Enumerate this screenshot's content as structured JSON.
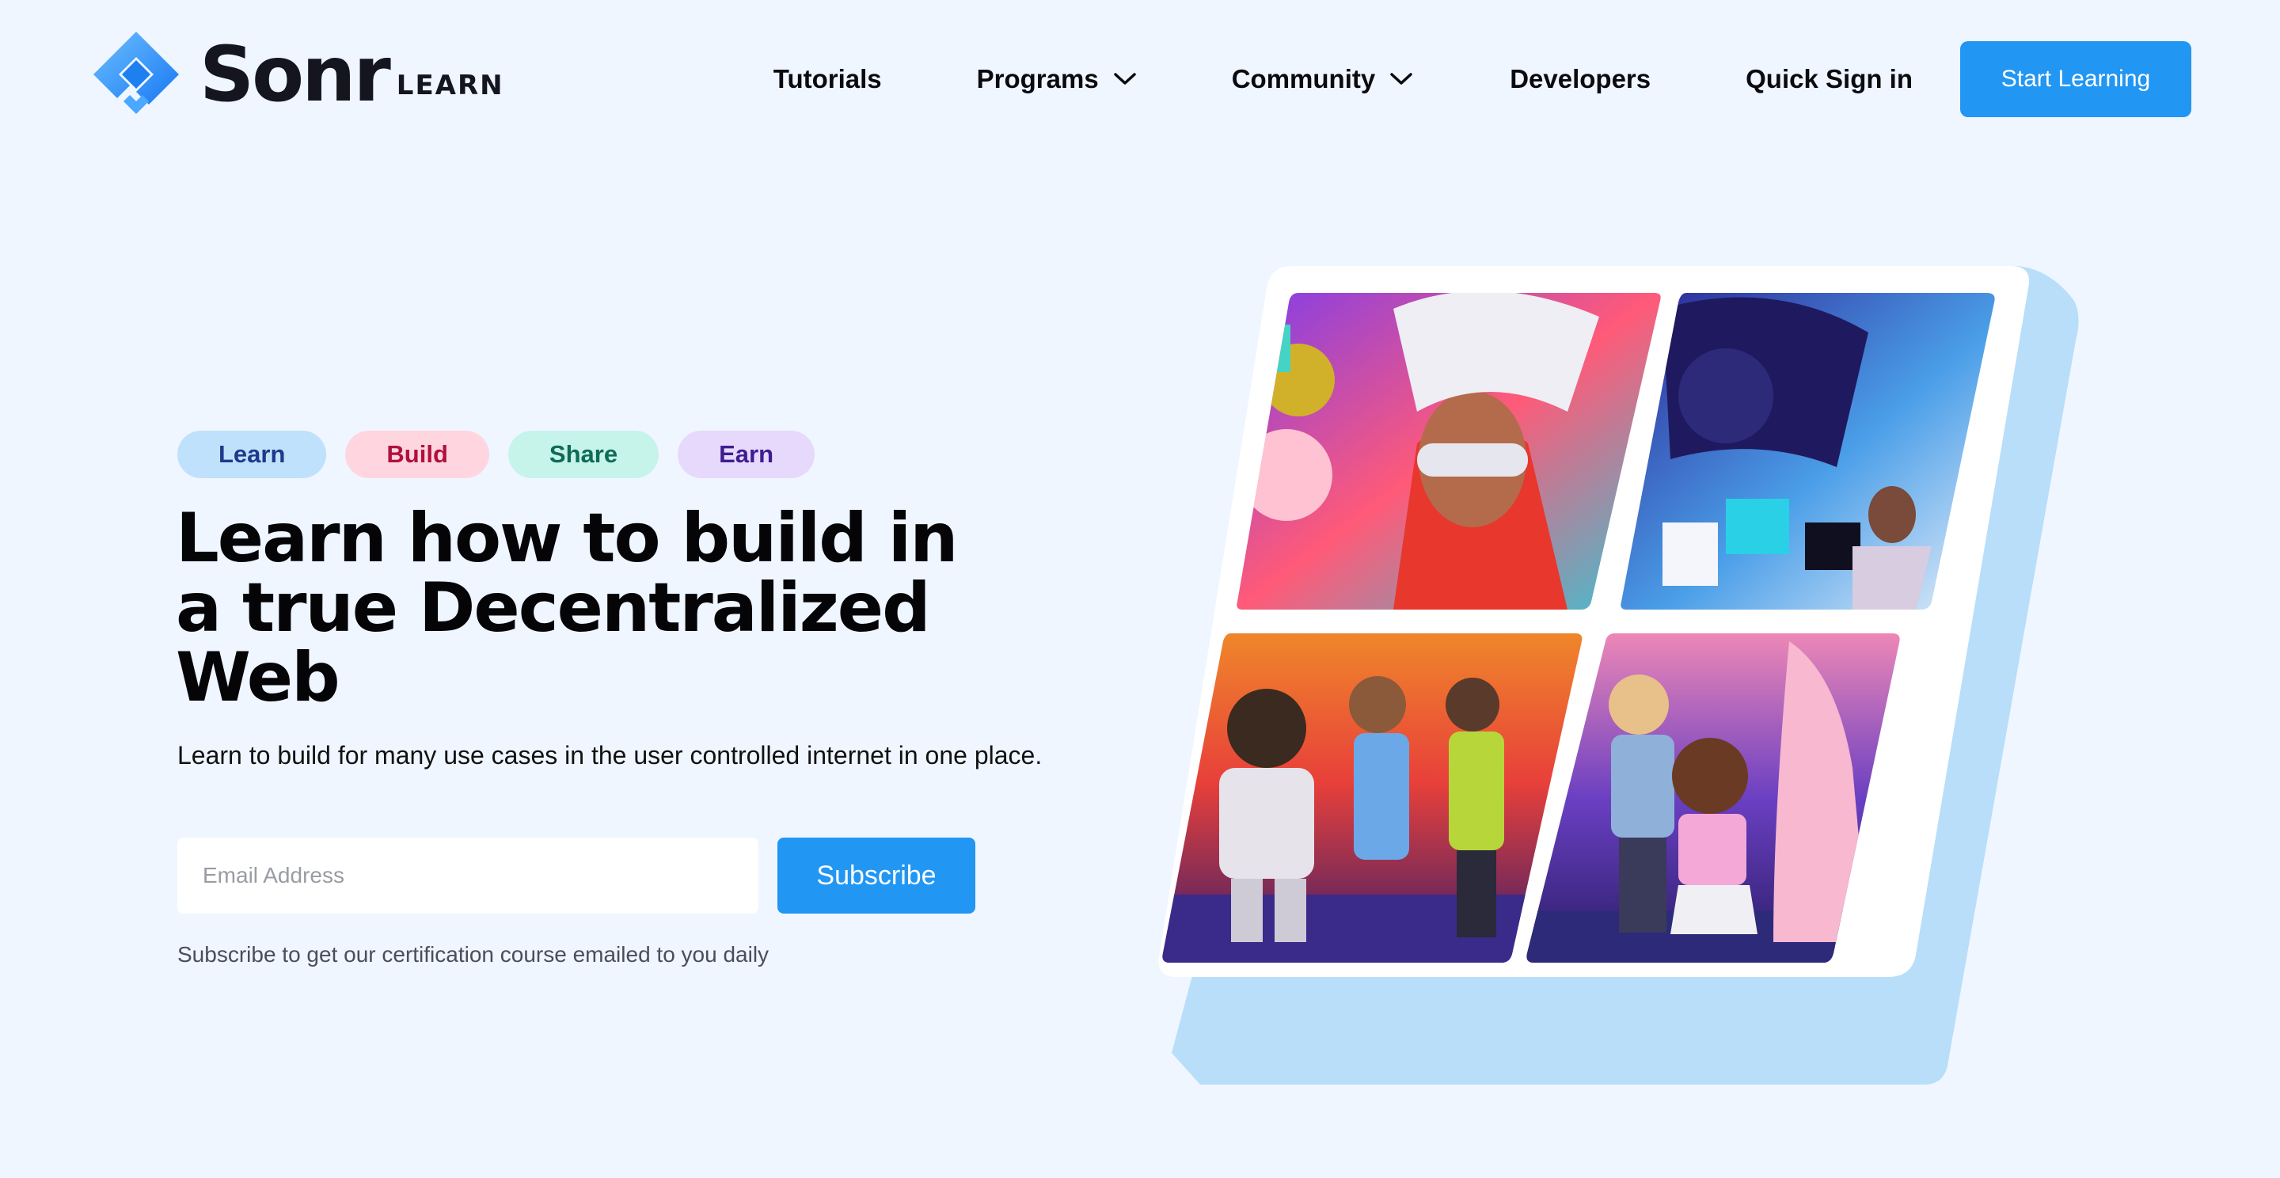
{
  "brand": {
    "name": "Sonr",
    "sub": "LEARN",
    "accent": "#2196f3"
  },
  "nav": {
    "items": [
      {
        "label": "Tutorials",
        "has_dropdown": false
      },
      {
        "label": "Programs",
        "has_dropdown": true
      },
      {
        "label": "Community",
        "has_dropdown": true
      },
      {
        "label": "Developers",
        "has_dropdown": false
      },
      {
        "label": "Quick Sign in",
        "has_dropdown": false
      }
    ],
    "cta_label": "Start Learning"
  },
  "hero": {
    "tags": [
      {
        "label": "Learn",
        "color": "#1e3a8a",
        "bg": "#bfe1fb"
      },
      {
        "label": "Build",
        "color": "#b0113c",
        "bg": "#ffd6e0"
      },
      {
        "label": "Share",
        "color": "#0f6b55",
        "bg": "#c6f3ea"
      },
      {
        "label": "Earn",
        "color": "#3f1d90",
        "bg": "#e6d9fb"
      }
    ],
    "headline": "Learn how to build in a true Decentralized Web",
    "subheadline": "Learn to build for many use cases in the user controlled internet in one place.",
    "email_placeholder": "Email Address",
    "subscribe_label": "Subscribe",
    "footnote": "Subscribe to get our certification course emailed to you daily"
  },
  "icons": [
    "sonr-logo-icon",
    "chevron-down-icon"
  ]
}
